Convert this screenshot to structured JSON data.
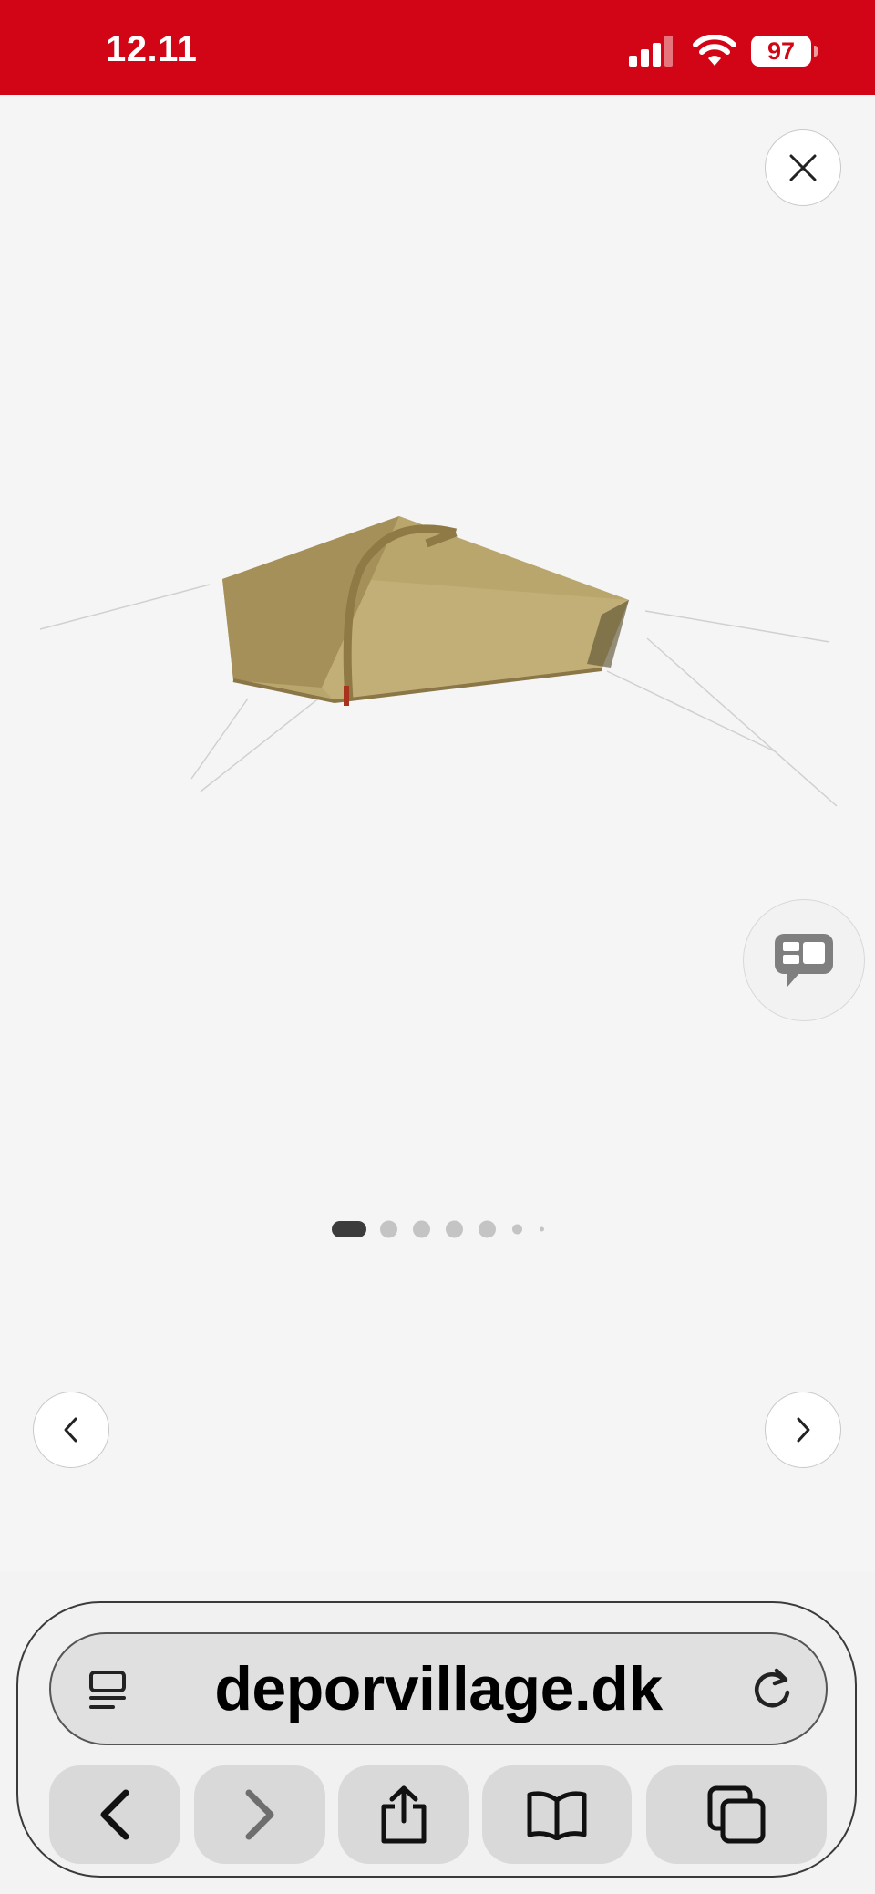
{
  "status_bar": {
    "time": "12.11",
    "battery": "97",
    "signal_icon": "cellular-signal-icon",
    "wifi_icon": "wifi-icon",
    "background_color": "#d10515"
  },
  "gallery": {
    "close_icon": "close-icon",
    "prev_icon": "chevron-left-icon",
    "next_icon": "chevron-right-icon",
    "chat_icon": "chat-bubble-icon",
    "image_subject": "tent-product-image",
    "slide_count": 7,
    "active_slide": 1
  },
  "browser": {
    "url": "deporvillage.dk",
    "reader_icon": "reader-mode-icon",
    "reload_icon": "reload-icon",
    "toolbar": [
      "back-icon",
      "forward-icon",
      "share-icon",
      "bookmarks-icon",
      "tabs-icon"
    ]
  }
}
